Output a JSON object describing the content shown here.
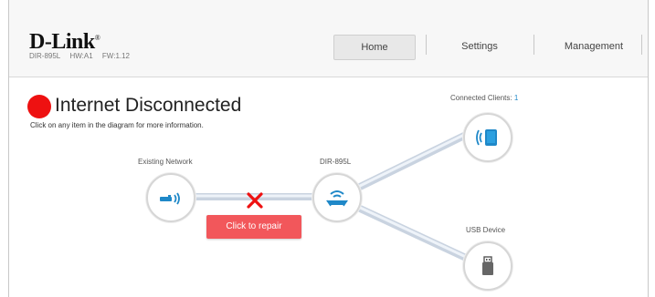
{
  "brand": {
    "logo_text": "D-Link",
    "model": "DIR-895L",
    "hw": "HW:A1",
    "fw": "FW:1.12"
  },
  "nav": {
    "home": "Home",
    "settings": "Settings",
    "management": "Management"
  },
  "status": {
    "title": "Internet Disconnected",
    "hint": "Click on any item in the diagram for more information.",
    "color": "#ee1111"
  },
  "diagram": {
    "existing_network_label": "Existing Network",
    "router_label": "DIR-895L",
    "clients_label": "Connected Clients:",
    "clients_count": "1",
    "usb_label": "USB Device",
    "repair_label": "Click to repair",
    "icons": {
      "existing_network": "modem-wireless-icon",
      "router": "router-icon",
      "clients": "wireless-tablet-icon",
      "usb": "usb-drive-icon",
      "disconnected": "red-x-icon"
    },
    "accent": "#2a8fc8",
    "error": "#ee1111"
  }
}
